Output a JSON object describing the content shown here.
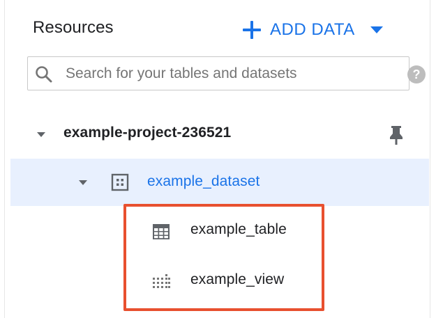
{
  "header": {
    "title": "Resources",
    "add_data_label": "ADD DATA"
  },
  "search": {
    "placeholder": "Search for your tables and datasets",
    "value": ""
  },
  "tree": {
    "project": {
      "name": "example-project-236521",
      "icon": "pin-icon"
    },
    "dataset": {
      "name": "example_dataset",
      "icon": "dataset-icon"
    },
    "items": [
      {
        "name": "example_table",
        "icon": "table-icon"
      },
      {
        "name": "example_view",
        "icon": "view-icon"
      }
    ]
  },
  "colors": {
    "accent": "#1a73e8",
    "selected_row": "#e8f0fe",
    "highlight_border": "#e8502f"
  }
}
